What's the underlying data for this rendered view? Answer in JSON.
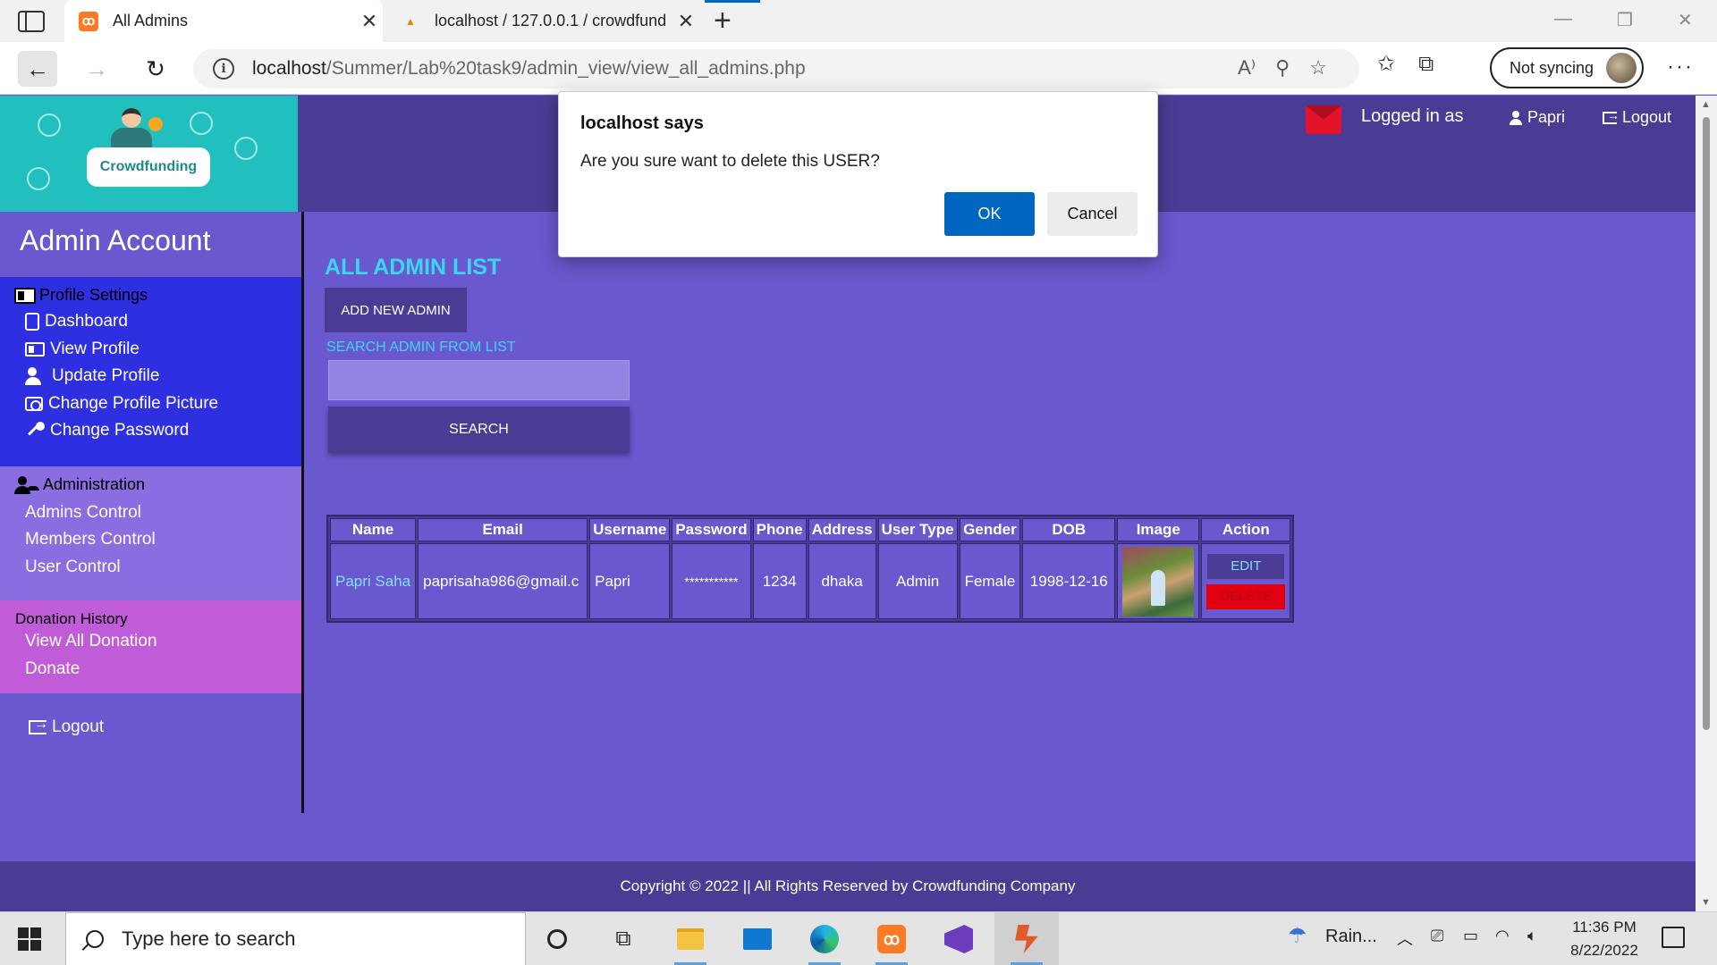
{
  "browser": {
    "tabs": [
      {
        "title": "All Admins",
        "favicon": "xampp-icon",
        "active": true
      },
      {
        "title": "localhost / 127.0.0.1 / crowdfund",
        "favicon": "phpmyadmin-icon",
        "active": false
      }
    ],
    "url_host": "localhost",
    "url_path": "/Summer/Lab%20task9/admin_view/view_all_admins.php",
    "sync_label": "Not syncing"
  },
  "header": {
    "logo_text": "Crowdfunding",
    "logged_in_label": "Logged in as",
    "user_name": "Papri",
    "logout_label": "Logout",
    "accent_mail": "#e4122b"
  },
  "sidebar": {
    "title": "Admin Account",
    "profile_heading": "Profile Settings",
    "profile_items": [
      "Dashboard",
      "View Profile",
      "Update Profile",
      "Change Profile Picture",
      "Change Password"
    ],
    "admin_heading": "Administration",
    "admin_items": [
      "Admins Control",
      "Members Control",
      "User Control"
    ],
    "donation_heading": "Donation History",
    "donation_items": [
      "View All Donation",
      "Donate"
    ],
    "logout_label": "Logout"
  },
  "main": {
    "title": "ALL ADMIN LIST",
    "add_button": "ADD NEW ADMIN",
    "search_label": "SEARCH ADMIN FROM LIST",
    "search_value": "",
    "search_button": "SEARCH",
    "table": {
      "headers": [
        "Name",
        "Email",
        "Username",
        "Password",
        "Phone",
        "Address",
        "User Type",
        "Gender",
        "DOB",
        "Image",
        "Action"
      ],
      "rows": [
        {
          "name": "Papri Saha",
          "email": "paprisaha986@gmail.c",
          "username": "Papri",
          "password": "***********",
          "phone": "1234",
          "address": "dhaka",
          "user_type": "Admin",
          "gender": "Female",
          "dob": "1998-12-16",
          "edit_label": "EDIT",
          "delete_label": "DELETE"
        }
      ]
    }
  },
  "footer": {
    "text": "Copyright © 2022 || All Rights Reserved by Crowdfunding Company"
  },
  "dialog": {
    "title": "localhost says",
    "message": "Are you sure want to delete this USER?",
    "ok_label": "OK",
    "cancel_label": "Cancel"
  },
  "taskbar": {
    "search_placeholder": "Type here to search",
    "weather": "Rain...",
    "time": "11:36 PM",
    "date": "8/22/2022"
  },
  "colors": {
    "page_bg": "#6a58cf",
    "header_bg": "#4a3c95",
    "logo_bg": "#21c0bf",
    "title_cyan": "#3ad6f0",
    "delete_red": "#e00010",
    "dialog_ok": "#0067c0"
  }
}
